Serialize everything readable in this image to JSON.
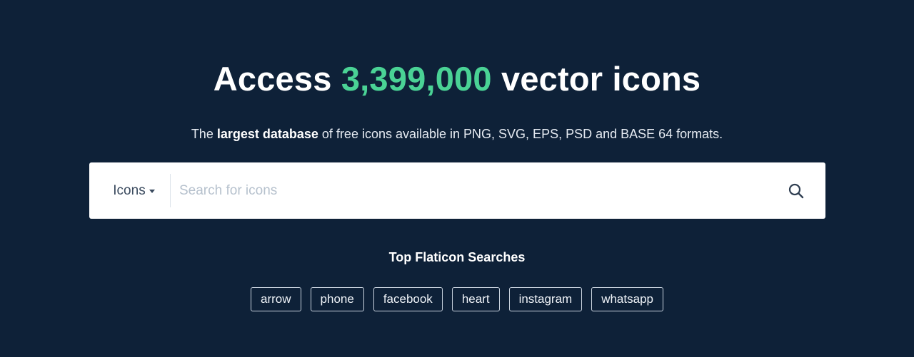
{
  "hero": {
    "title_prefix": "Access ",
    "title_count": "3,399,000",
    "title_suffix": " vector icons",
    "subtitle_before": "The ",
    "subtitle_bold": "largest database",
    "subtitle_after": " of free icons available in PNG, SVG, EPS, PSD and BASE 64 formats."
  },
  "search": {
    "category_label": "Icons",
    "category_icon": "caret-down-icon",
    "placeholder": "Search for icons",
    "value": "",
    "button_icon": "magnifier-icon"
  },
  "top_searches": {
    "title": "Top Flaticon Searches",
    "tags": [
      "arrow",
      "phone",
      "facebook",
      "heart",
      "instagram",
      "whatsapp"
    ]
  },
  "colors": {
    "background": "#0e2138",
    "accent": "#4ad295",
    "search_background": "#ffffff",
    "tag_border": "#c9d3df"
  }
}
